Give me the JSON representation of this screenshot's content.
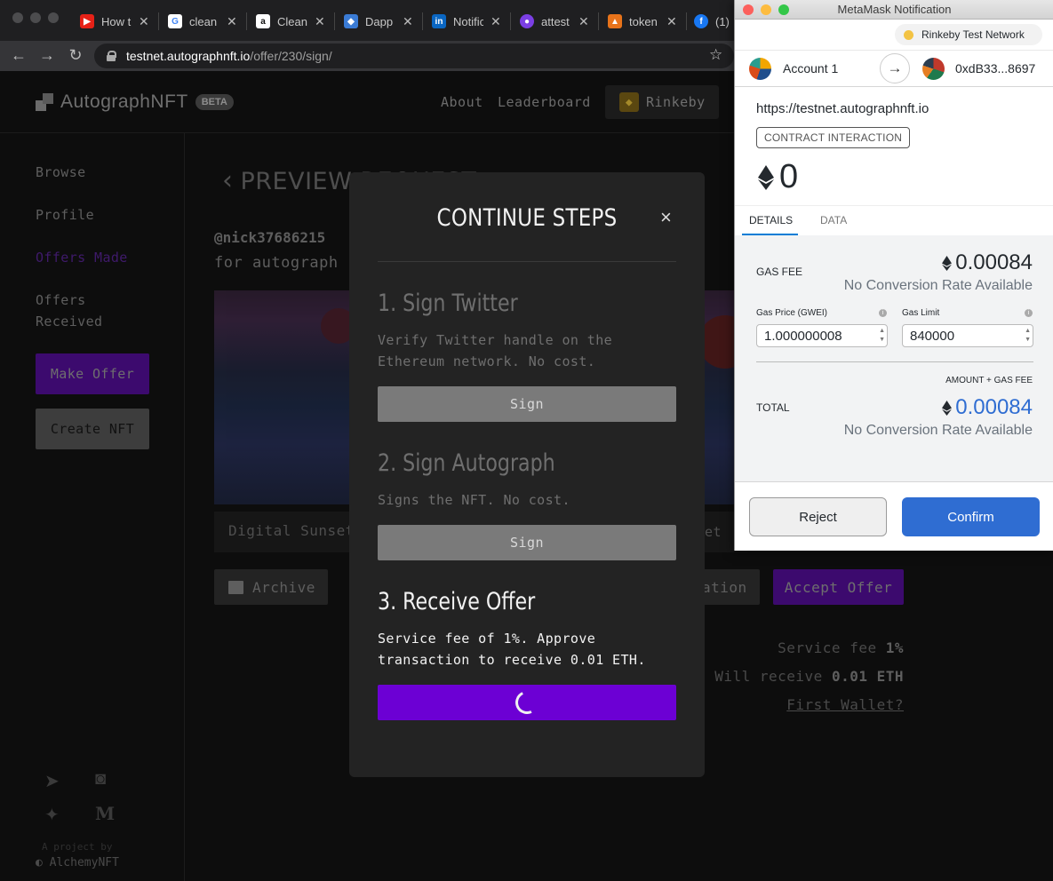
{
  "browser": {
    "tabs": [
      {
        "title": "How t",
        "icon": "youtube-icon",
        "color": "#e62117"
      },
      {
        "title": "clean",
        "icon": "google-icon",
        "color": "#ffffff"
      },
      {
        "title": "Clean",
        "icon": "amazon-icon",
        "color": "#ffffff"
      },
      {
        "title": "Dapp",
        "icon": "dapp-icon",
        "color": "#3a7bd5"
      },
      {
        "title": "Notific",
        "icon": "linkedin-icon",
        "color": "#0a66c2"
      },
      {
        "title": "attest",
        "icon": "attest-icon",
        "color": "#7b3fe4"
      },
      {
        "title": "token",
        "icon": "token-icon",
        "color": "#e8731a"
      },
      {
        "title": "(1)",
        "icon": "facebook-icon",
        "color": "#1877f2"
      }
    ],
    "url_domain": "testnet.autographnft.io",
    "url_path": "/offer/230/sign/"
  },
  "site": {
    "logo_text": "AutographNFT",
    "beta": "BETA",
    "nav_about": "About",
    "nav_leaderboard": "Leaderboard",
    "network": "Rinkeby"
  },
  "sidebar": {
    "browse": "Browse",
    "profile": "Profile",
    "offers_made": "Offers Made",
    "offers_received_1": "Offers",
    "offers_received_2": "Received",
    "make_offer": "Make Offer",
    "create_nft": "Create NFT",
    "project_by": "A project by",
    "alchemy": "AlchemyNFT"
  },
  "main": {
    "title": "PREVIEW REQUEST",
    "handle": "@nick37686215",
    "for_autograph": "for autograph",
    "caption": "Digital Sunset",
    "caption_right": "et",
    "archive": "Archive",
    "ation": "ation",
    "accept_offer": "Accept Offer",
    "service_fee_label": "Service fee",
    "service_fee_value": "1%",
    "will_receive_label": "Will receive",
    "will_receive_value": "0.01 ETH",
    "first_wallet": "First Wallet?"
  },
  "modal": {
    "title": "CONTINUE STEPS",
    "close": "×",
    "step1_title": "1. Sign Twitter",
    "step1_desc": "Verify Twitter handle on the Ethereum network. No cost.",
    "step1_button": "Sign",
    "step2_title": "2. Sign Autograph",
    "step2_desc": "Signs the NFT. No cost.",
    "step2_button": "Sign",
    "step3_title": "3. Receive Offer",
    "step3_desc": "Service fee of 1%. Approve transaction to receive 0.01 ETH."
  },
  "metamask": {
    "window_title": "MetaMask Notification",
    "network": "Rinkeby Test Network",
    "account_name": "Account 1",
    "to_address": "0xdB33...8697",
    "origin": "https://testnet.autographnft.io",
    "badge": "CONTRACT INTERACTION",
    "amount": "0",
    "tab_details": "DETAILS",
    "tab_data": "DATA",
    "gas_fee_label": "GAS FEE",
    "gas_fee_value": "0.00084",
    "no_conversion": "No Conversion Rate Available",
    "gas_price_label": "Gas Price (GWEI)",
    "gas_limit_label": "Gas Limit",
    "gas_price_value": "1.000000008",
    "gas_limit_value": "840000",
    "amount_gas_fee": "AMOUNT + GAS FEE",
    "total_label": "TOTAL",
    "total_value": "0.00084",
    "no_conversion_total": "No Conversion Rate Available",
    "reject": "Reject",
    "confirm": "Confirm"
  },
  "colors": {
    "accent_purple": "#6c00d4",
    "metamask_blue": "#2f6dd2"
  }
}
